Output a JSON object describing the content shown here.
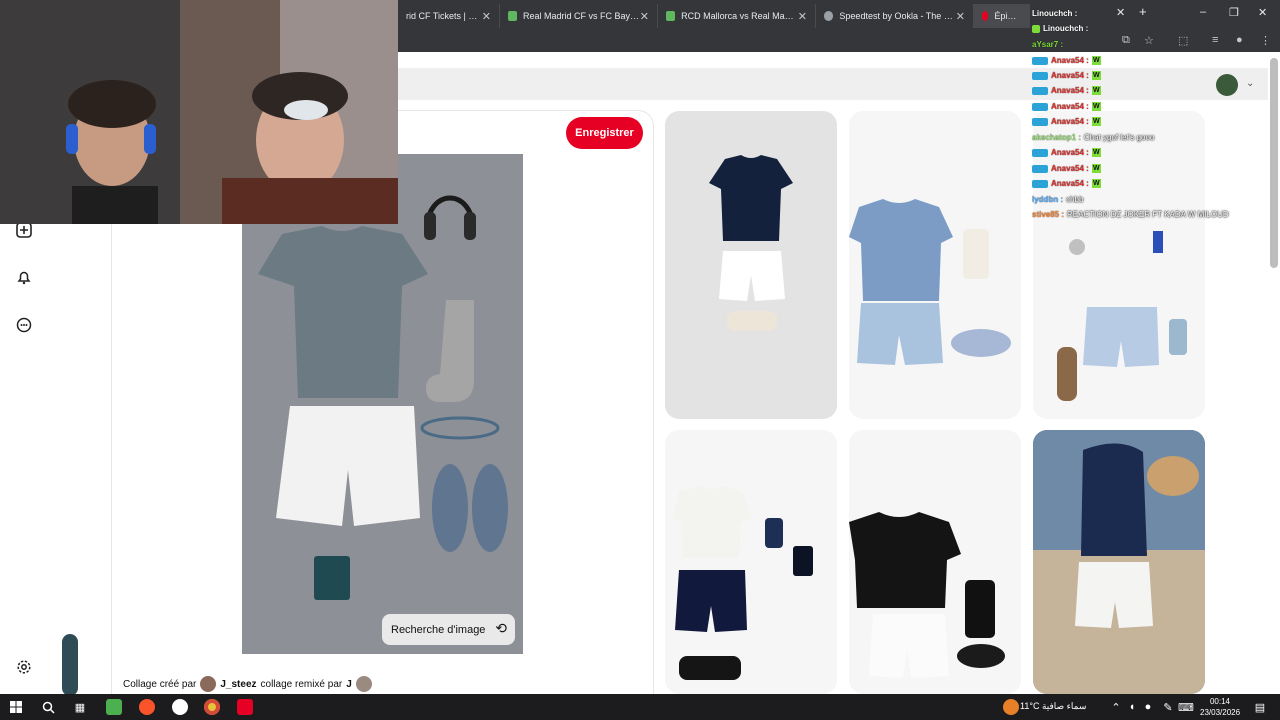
{
  "browser": {
    "tabs": [
      {
        "label": "rid CF Tickets | Buy on",
        "fav_color": "#6b6b6b"
      },
      {
        "label": "Real Madrid CF vs FC Bayern M",
        "fav_color": "#5fb85f"
      },
      {
        "label": "RCD Mallorca vs Real Madrid C",
        "fav_color": "#5fb85f"
      },
      {
        "label": "Speedtest by Ookla - The Glob",
        "fav_color": "#9aa0a6"
      },
      {
        "label": "Épinglé su",
        "fav_color": "#e60023"
      }
    ],
    "new_tab_symbol": "+",
    "window_controls": [
      "–",
      "❐",
      "✕"
    ]
  },
  "pinterest": {
    "save_label": "Enregistrer",
    "image_search_label": "Recherche d'image",
    "credit": {
      "prefix": "Collage créé par",
      "user1": "J_steez",
      "middle": "collage remixé par",
      "user2": "J"
    },
    "rail_icons": [
      "plus-icon",
      "bell-icon",
      "chat-icon",
      "settings-icon"
    ],
    "accent": "#e60023"
  },
  "chat": {
    "header_lines": [
      {
        "user": "Linouchch :",
        "color": "#ffffff"
      },
      {
        "user": "Linouchch :",
        "color": "#ffffff"
      },
      {
        "user": "aYsar7 :",
        "color": "#7ddc3a"
      }
    ],
    "messages": [
      {
        "user": "Anava54 :",
        "msg": "W"
      },
      {
        "user": "Anava54 :",
        "msg": "W"
      },
      {
        "user": "Anava54 :",
        "msg": "W"
      },
      {
        "user": "Anava54 :",
        "msg": "W"
      },
      {
        "user": "Anava54 :",
        "msg": "W"
      },
      {
        "user": "akechatop1 :",
        "msg": "Chat ygof let's gooo",
        "color": "#9be07a"
      },
      {
        "user": "Anava54 :",
        "msg": "W"
      },
      {
        "user": "Anava54 :",
        "msg": "W"
      },
      {
        "user": "Anava54 :",
        "msg": "W"
      },
      {
        "user": "lyddbn :",
        "msg": "chbb",
        "color": "#5ab0ff"
      },
      {
        "user": "stive85 :",
        "msg": "REACTION DZ JOKER FT KADA W MILOUD",
        "color": "#ff8a3a"
      }
    ]
  },
  "taskbar": {
    "weather": "11°C  سماء صافية",
    "time": "00:14",
    "date": "23/03/2026"
  }
}
